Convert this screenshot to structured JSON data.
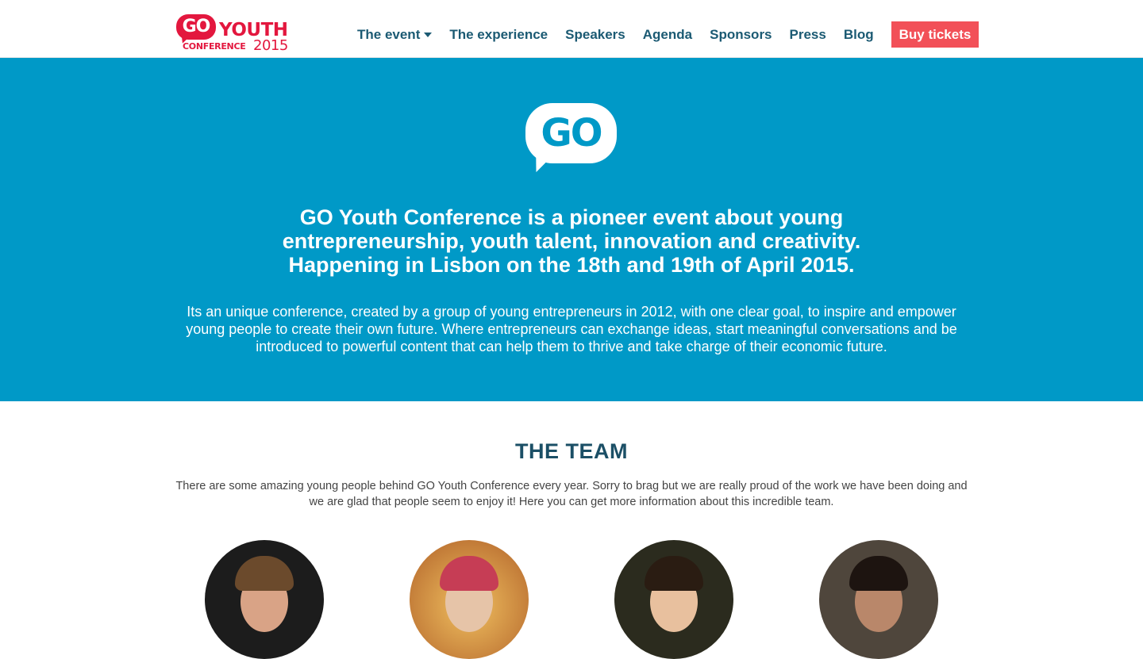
{
  "header": {
    "logo": {
      "go": "GO",
      "youth": "YOUTH",
      "conference": "CONFERENCE",
      "year": "2015"
    },
    "nav": [
      {
        "label": "The event",
        "has_dropdown": true
      },
      {
        "label": "The experience"
      },
      {
        "label": "Speakers"
      },
      {
        "label": "Agenda"
      },
      {
        "label": "Sponsors"
      },
      {
        "label": "Press"
      },
      {
        "label": "Blog"
      }
    ],
    "cta_label": "Buy tickets"
  },
  "hero": {
    "logo_text": "GO",
    "title_lines": [
      "GO Youth Conference is a pioneer event about young",
      "entrepreneurship, youth talent, innovation and creativity.",
      "Happening in Lisbon on the 18th and 19th of April 2015."
    ],
    "description": "Its an unique conference, created by a group of young entrepreneurs in 2012, with one clear goal, to inspire and empower young people to create their own future. Where entrepreneurs can exchange ideas, start meaningful conversations and be introduced to powerful content that can help them to thrive and take charge of their economic future."
  },
  "team": {
    "title": "THE TEAM",
    "description": "There are some amazing young people behind GO Youth Conference every year. Sorry to brag but we are really proud of the work we have been doing and we are glad that people seem to enjoy it! Here you can get more information about this incredible team."
  },
  "colors": {
    "brand_red": "#e3173e",
    "hero_blue": "#0099c7",
    "nav_text": "#1b5a73",
    "cta_bg": "#f25058"
  }
}
